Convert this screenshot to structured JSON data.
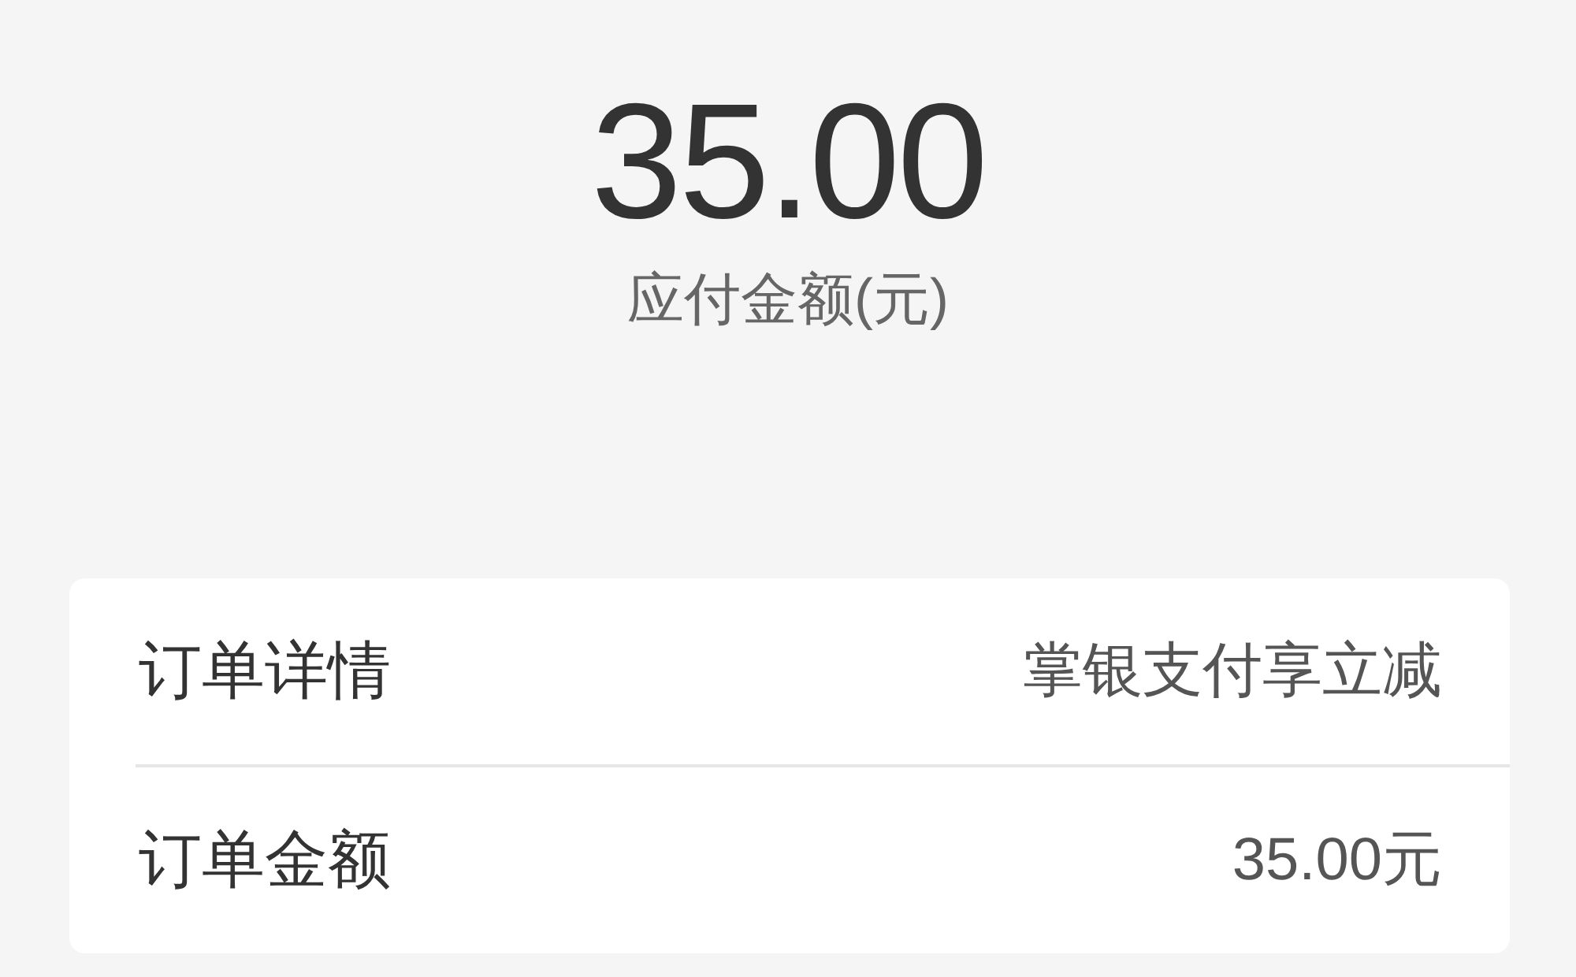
{
  "amount": {
    "value": "35.00",
    "label": "应付金额(元)"
  },
  "order_card": {
    "rows": [
      {
        "label": "订单详情",
        "value": "掌银支付享立减"
      },
      {
        "label": "订单金额",
        "value": "35.00元"
      }
    ]
  }
}
